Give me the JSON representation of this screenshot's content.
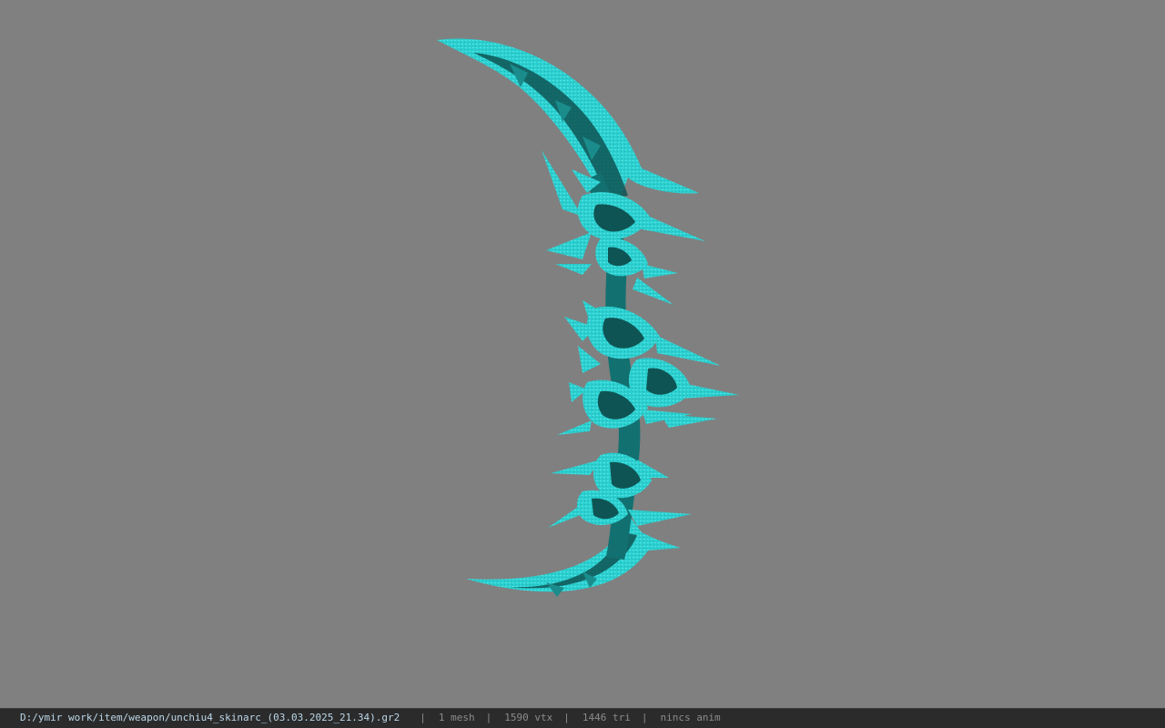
{
  "viewport": {
    "background_color": "#808080",
    "model": {
      "color_primary": "#2ccfcf",
      "color_dark": "#0d4a4a"
    }
  },
  "status_bar": {
    "file_path": "D:/ymir work/item/weapon/unchiu4_skinarc_(03.03.2025_21.34).gr2",
    "mesh_count": "1 mesh",
    "vertex_count": "1590 vtx",
    "triangle_count": "1446 tri",
    "anim_status": "nincs anim",
    "separator": "|"
  }
}
